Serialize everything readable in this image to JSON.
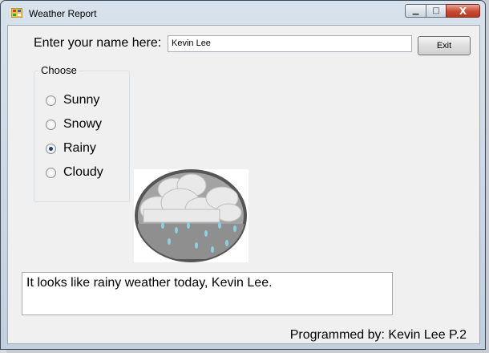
{
  "window": {
    "title": "Weather Report",
    "caption_buttons": {
      "minimize": "▁",
      "maximize": "□",
      "close": "X"
    }
  },
  "form": {
    "name_label": "Enter your name here:",
    "name_value": "Kevin Lee",
    "exit_label": "Exit",
    "group_label": "Choose",
    "options": [
      {
        "label": "Sunny",
        "checked": false
      },
      {
        "label": "Snowy",
        "checked": false
      },
      {
        "label": "Rainy",
        "checked": true
      },
      {
        "label": "Cloudy",
        "checked": false
      }
    ],
    "output_text": "It looks like rainy weather today, Kevin Lee.",
    "credit": "Programmed by: Kevin Lee P.2"
  },
  "colors": {
    "close_button": "#c84a33",
    "radio_dot": "#1e3f7a"
  }
}
